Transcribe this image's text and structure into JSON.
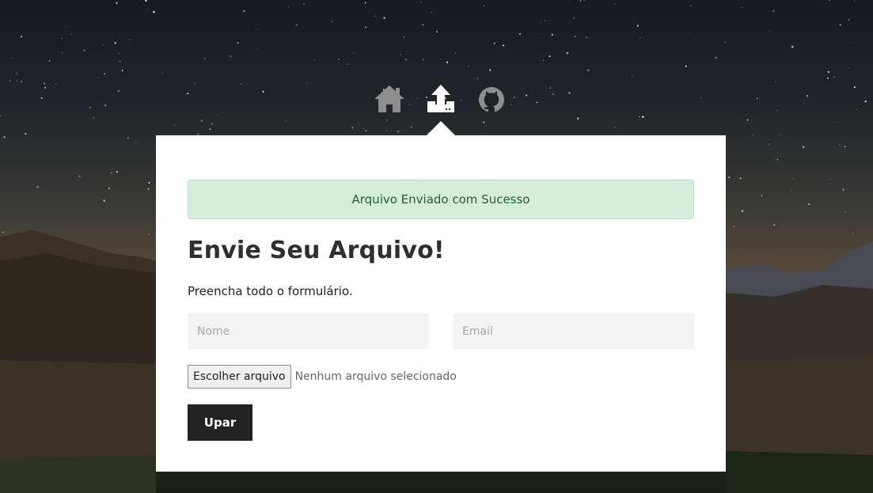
{
  "nav": {
    "items": [
      {
        "icon": "home-icon",
        "color": "#8e8e8e"
      },
      {
        "icon": "upload-icon",
        "color": "#ffffff",
        "active": true
      },
      {
        "icon": "github-icon",
        "color": "#8e8e8e"
      }
    ]
  },
  "alert": {
    "text": "Arquivo Enviado com Sucesso",
    "background": "#d4eddb",
    "color": "#2b5a38"
  },
  "form": {
    "title": "Envie Seu Arquivo!",
    "subtitle": "Preencha todo o formulário.",
    "name_placeholder": "Nome",
    "name_value": "",
    "email_placeholder": "Email",
    "email_value": "",
    "file_button_label": "Escolher arquivo",
    "file_status": "Nenhum arquivo selecionado",
    "submit_label": "Upar"
  },
  "colors": {
    "card": "#ffffff",
    "button": "#232323"
  }
}
